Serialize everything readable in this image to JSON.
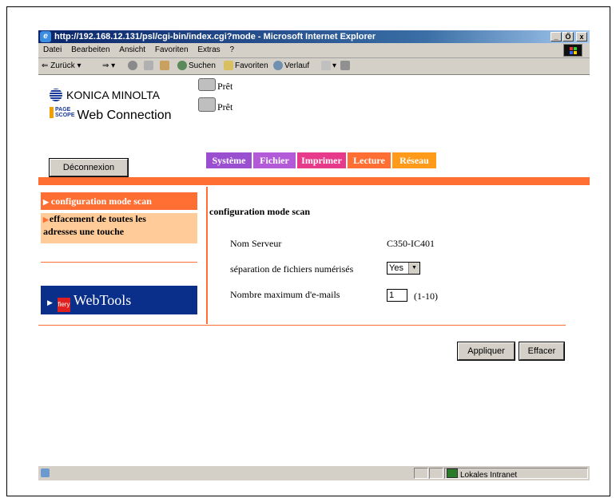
{
  "window": {
    "title": "http://192.168.12.131/psl/cgi-bin/index.cgi?mode - Microsoft Internet Explorer",
    "minimize": "_",
    "maximize": "Ő",
    "close": "x"
  },
  "menubar": [
    "Datei",
    "Bearbeiten",
    "Ansicht",
    "Favoriten",
    "Extras",
    "?"
  ],
  "toolbar": {
    "back": "⇐ Zurück",
    "search": "Suchen",
    "favorites": "Favoriten",
    "history": "Verlauf"
  },
  "brand": {
    "konica": "KONICA MINOLTA",
    "ps_top": "PAGE",
    "ps_bottom": "SCOPE",
    "webconn": "Web Connection"
  },
  "status": [
    "Prêt",
    "Prêt"
  ],
  "logout_label": "Déconnexion",
  "tabs": [
    {
      "label": "Système",
      "color": "#9a4fd0"
    },
    {
      "label": "Fichier",
      "color": "#b35ad8"
    },
    {
      "label": "Imprimer",
      "color": "#e83a8a"
    },
    {
      "label": "Lecture",
      "color": "#ff6e32"
    },
    {
      "label": "Réseau",
      "color": "#ff9a1a"
    }
  ],
  "nav": {
    "item1": "configuration mode scan",
    "item2_line1": "effacement de toutes les",
    "item2_line2": "adresses une touche",
    "webtools": "WebTools",
    "webtools_badge": "fiery"
  },
  "main": {
    "title": "configuration mode scan",
    "server_label": "Nom Serveur",
    "server_value": "C350-IC401",
    "sep_label": "séparation de fichiers numérisés",
    "sep_value": "Yes",
    "max_label": "Nombre maximum d'e-mails",
    "max_value": "1",
    "max_range": "(1-10)"
  },
  "buttons": {
    "apply": "Appliquer",
    "clear": "Effacer"
  },
  "statusbar": {
    "zone": "Lokales Intranet"
  },
  "colors": {
    "accent": "#ff6e32",
    "nav_selected": "#ff6e32",
    "nav_unselected": "#ffcc99",
    "webtools_bg": "#0a2f8a"
  }
}
